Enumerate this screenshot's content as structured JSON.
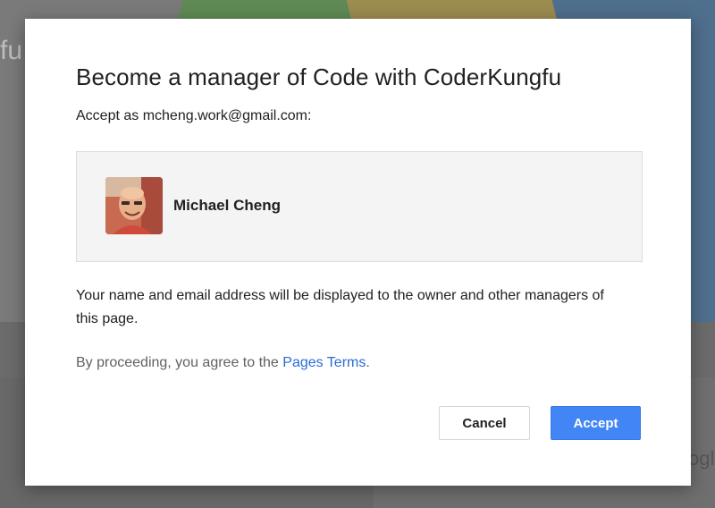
{
  "background": {
    "title_fragment": "fu",
    "right_fragment": "ogl"
  },
  "dialog": {
    "title": "Become a manager of Code with CoderKungfu",
    "accept_as": "Accept as mcheng.work@gmail.com:",
    "profile": {
      "name": "Michael Cheng"
    },
    "info": "Your name and email address will be displayed to the owner and other managers of this page.",
    "terms_prefix": "By proceeding, you agree to the ",
    "terms_link": "Pages Terms",
    "terms_suffix": ".",
    "cancel_label": "Cancel",
    "accept_label": "Accept"
  },
  "colors": {
    "accent": "#4285f4",
    "link": "#2a6bd6"
  }
}
